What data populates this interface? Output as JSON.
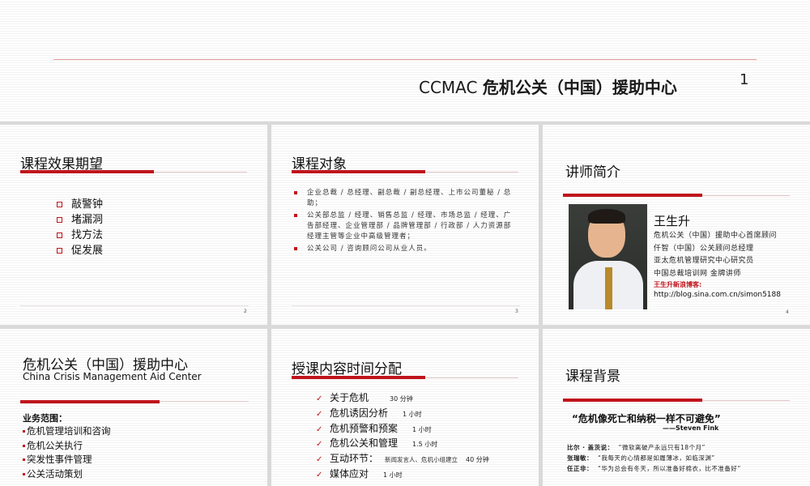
{
  "hero": {
    "title_en": "CCMAC ",
    "title_zh": "危机公关（中国）援助中心",
    "page_num": "1"
  },
  "slide2": {
    "heading": "课程效果期望",
    "items": [
      "敲警钟",
      "堵漏洞",
      "找方法",
      "促发展"
    ],
    "page_num": "2"
  },
  "slide3": {
    "heading": "课程对象",
    "items": [
      "企业总裁 / 总经理、副总裁 / 副总经理、上市公司董秘 / 总助；",
      "公关部总监 / 经理、销售总监 / 经理、市场总监 / 经理、广告部经理、企业管理部 / 品牌管理部 / 行政部 / 人力资源部经理主管等企业中高级管理者；",
      "公关公司 / 咨询顾问公司从业人员。"
    ],
    "page_num": "3"
  },
  "slide4": {
    "heading": "讲师简介",
    "name": "王生升",
    "lines": [
      "危机公关（中国）援助中心首席顾问",
      "仟智（中国）公关顾问总经理",
      "亚太危机管理研究中心研究员",
      "中国总裁培训网 金牌讲师"
    ],
    "blog_label": "王生升新浪博客:",
    "blog_url": "http://blog.sina.com.cn/simon5188",
    "page_num": "4"
  },
  "slide5": {
    "title_zh": "危机公关（中国）援助中心",
    "title_en": "China Crisis Management Aid Center",
    "scope_title": "业务范围：",
    "scope": [
      "危机管理培训和咨询",
      "危机公关执行",
      "突发性事件管理",
      "公关活动策划"
    ]
  },
  "slide6": {
    "heading": "授课内容时间分配",
    "items": [
      {
        "label": "关于危机",
        "note": "",
        "time": "30 分钟"
      },
      {
        "label": "危机诱因分析",
        "note": "",
        "time": "1 小时"
      },
      {
        "label": "危机预警和预案",
        "note": "",
        "time": "1 小时"
      },
      {
        "label": "危机公关和管理",
        "note": "",
        "time": "1.5 小时"
      },
      {
        "label": "互动环节：",
        "note": "新闻发言人、危机小组建立",
        "time": "40 分钟"
      },
      {
        "label": "媒体应对",
        "note": "",
        "time": "1 小时"
      }
    ]
  },
  "slide7": {
    "heading": "课程背景",
    "quote": "“危机像死亡和纳税一样不可避免”",
    "quote_author": "——Steven Fink",
    "lines": [
      {
        "who": "比尔 · 盖茨说：",
        "text": "“微软离破产永远只有18个月”"
      },
      {
        "who": "张瑞敏：",
        "text": "“我每天的心情都是如履薄冰，如临深渊”"
      },
      {
        "who": "任正非：",
        "text": "“华为总会有冬天，所以准备好棉衣，比不准备好”"
      }
    ]
  }
}
